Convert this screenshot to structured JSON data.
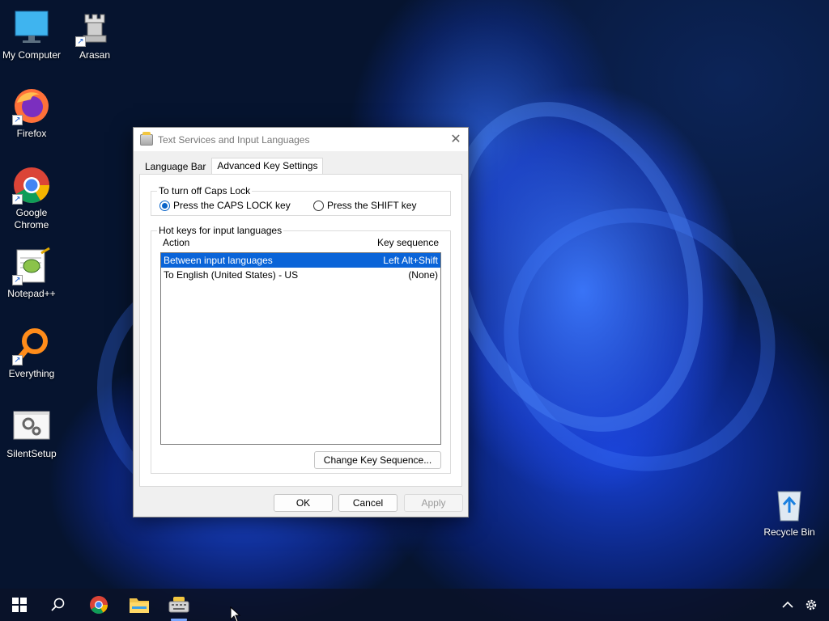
{
  "desktop": {
    "icons": [
      {
        "label": "My Computer",
        "icon": "monitor-icon"
      },
      {
        "label": "Arasan",
        "icon": "chess-rook-icon"
      },
      {
        "label": "Firefox",
        "icon": "firefox-icon"
      },
      {
        "label": "Google Chrome",
        "icon": "chrome-icon"
      },
      {
        "label": "Notepad++",
        "icon": "notepadpp-icon"
      },
      {
        "label": "Everything",
        "icon": "magnifier-icon"
      },
      {
        "label": "SilentSetup",
        "icon": "gears-icon"
      },
      {
        "label": "Recycle Bin",
        "icon": "recycle-bin-icon"
      }
    ]
  },
  "dialog": {
    "title": "Text Services and Input Languages",
    "tabs": [
      {
        "label": "Language Bar",
        "active": false
      },
      {
        "label": "Advanced Key Settings",
        "active": true
      }
    ],
    "caps_lock": {
      "legend": "To turn off Caps Lock",
      "options": [
        {
          "label": "Press the CAPS LOCK key",
          "checked": true
        },
        {
          "label": "Press the SHIFT key",
          "checked": false
        }
      ]
    },
    "hotkeys": {
      "legend": "Hot keys for input languages",
      "col_action": "Action",
      "col_sequence": "Key sequence",
      "rows": [
        {
          "action": "Between input languages",
          "sequence": "Left Alt+Shift",
          "selected": true
        },
        {
          "action": "To English (United States) - US",
          "sequence": "(None)",
          "selected": false
        }
      ],
      "change_button": "Change Key Sequence..."
    },
    "buttons": {
      "ok": "OK",
      "cancel": "Cancel",
      "apply": "Apply"
    }
  },
  "taskbar": {
    "items": [
      "start-icon",
      "search-icon",
      "chrome-icon",
      "file-explorer-icon",
      "keyboard-icon"
    ],
    "tray": [
      "chevron-up-icon",
      "gear-icon"
    ]
  },
  "colors": {
    "selection": "#0a64d8",
    "radio_accent": "#0a64c8"
  }
}
